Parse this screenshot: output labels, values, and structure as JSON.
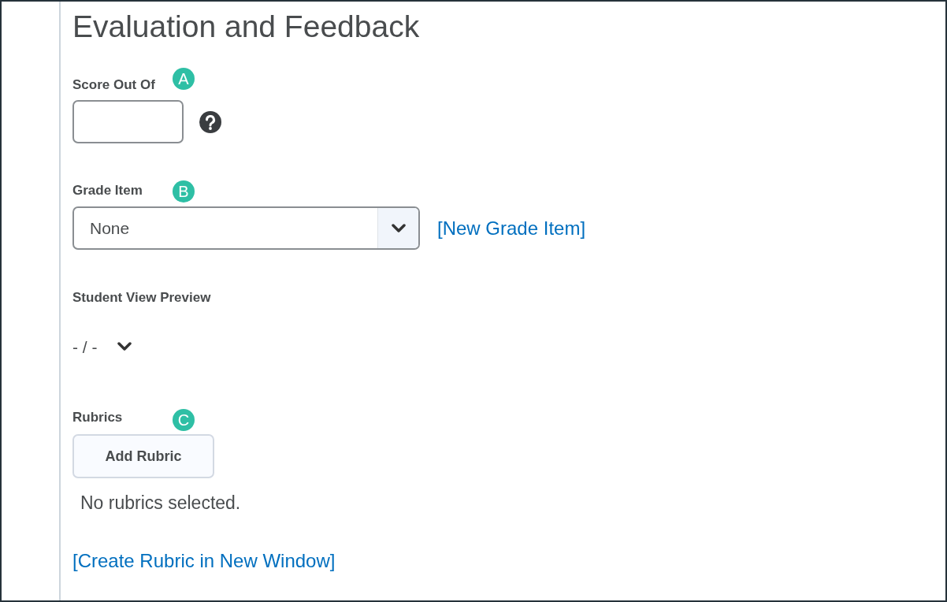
{
  "heading": "Evaluation and Feedback",
  "score": {
    "label": "Score Out Of",
    "marker": "A"
  },
  "grade_item": {
    "label": "Grade Item",
    "marker": "B",
    "value": "None",
    "link": "[New Grade Item]"
  },
  "preview": {
    "label": "Student View Preview",
    "value": "- / -",
    "expanded": false
  },
  "rubrics": {
    "label": "Rubrics",
    "marker": "C",
    "button": "Add Rubric",
    "status": "No rubrics selected.",
    "link": "[Create Rubric in New Window]"
  }
}
